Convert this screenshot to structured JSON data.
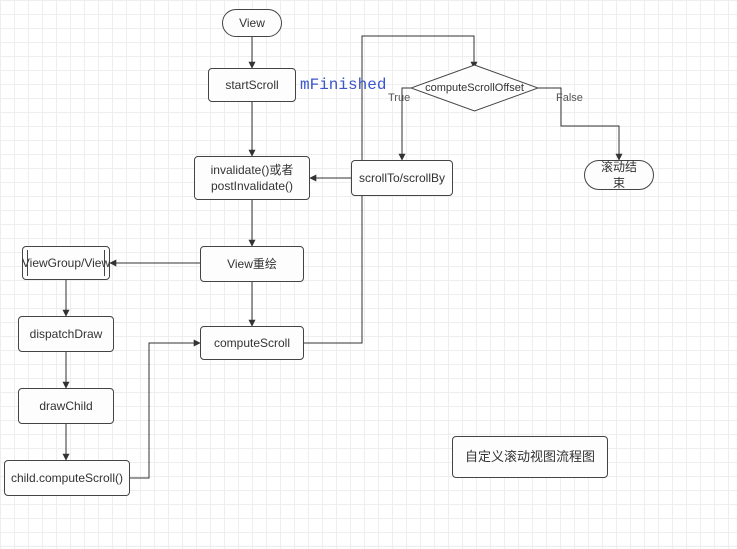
{
  "nodes": {
    "view": "View",
    "startScroll": "startScroll",
    "invalidate": "invalidate()或者\npostInvalidate()",
    "viewRedraw": "View重绘",
    "computeScroll": "computeScroll",
    "viewGroup": "ViewGroup/View",
    "dispatchDraw": "dispatchDraw",
    "drawChild": "drawChild",
    "childCompute": "child.computeScroll()",
    "scrollTo": "scrollTo/scrollBy",
    "computeOffset": "computeScrollOffset",
    "scrollEnd": "滚动结束",
    "caption": "自定义滚动视图流程图"
  },
  "labels": {
    "mFinished": "mFinished",
    "trueLabel": "True",
    "falseLabel": "False"
  }
}
